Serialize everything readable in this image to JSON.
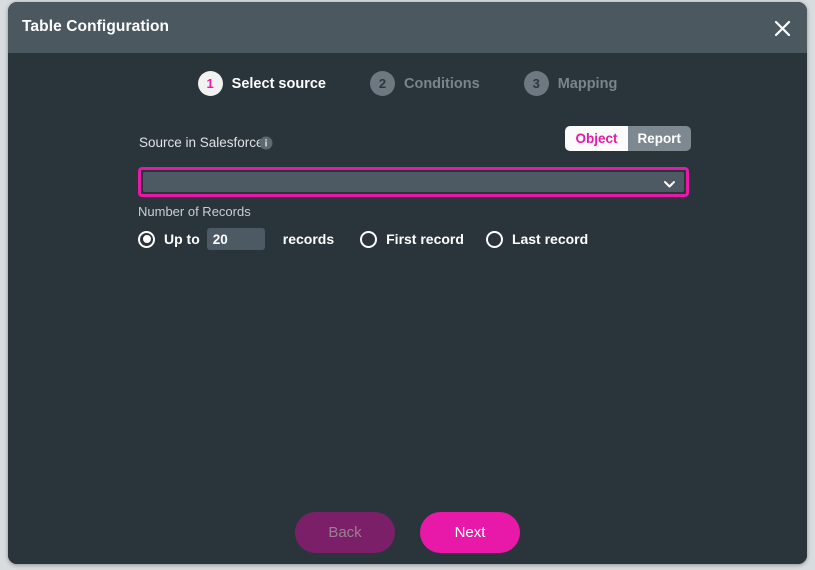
{
  "window": {
    "title": "Table Configuration",
    "close_icon": "close-icon"
  },
  "stepper": {
    "steps": [
      {
        "number": "1",
        "label": "Select source",
        "state": "active"
      },
      {
        "number": "2",
        "label": "Conditions",
        "state": "inactive"
      },
      {
        "number": "3",
        "label": "Mapping",
        "state": "inactive"
      }
    ]
  },
  "source": {
    "label": "Source in Salesforce",
    "info_icon": "info-icon",
    "toggle": {
      "options": [
        {
          "label": "Object",
          "selected": true
        },
        {
          "label": "Report",
          "selected": false
        }
      ]
    },
    "select": {
      "value": "",
      "placeholder": "",
      "chevron_icon": "chevron-down-icon",
      "focused": true
    }
  },
  "records": {
    "label": "Number of Records",
    "options": [
      {
        "label": "Up to",
        "suffix": "records",
        "selected": true,
        "value": "20"
      },
      {
        "label": "First record",
        "selected": false
      },
      {
        "label": "Last record",
        "selected": false
      }
    ]
  },
  "footer": {
    "back_label": "Back",
    "next_label": "Next"
  },
  "colors": {
    "accent": "#e818a8",
    "accent_disabled": "#7b2068",
    "header_bar": "#4c5860",
    "dialog_body": "#2a343b",
    "field_bg": "#4e5a63",
    "page_bg": "#d8dcdf"
  }
}
